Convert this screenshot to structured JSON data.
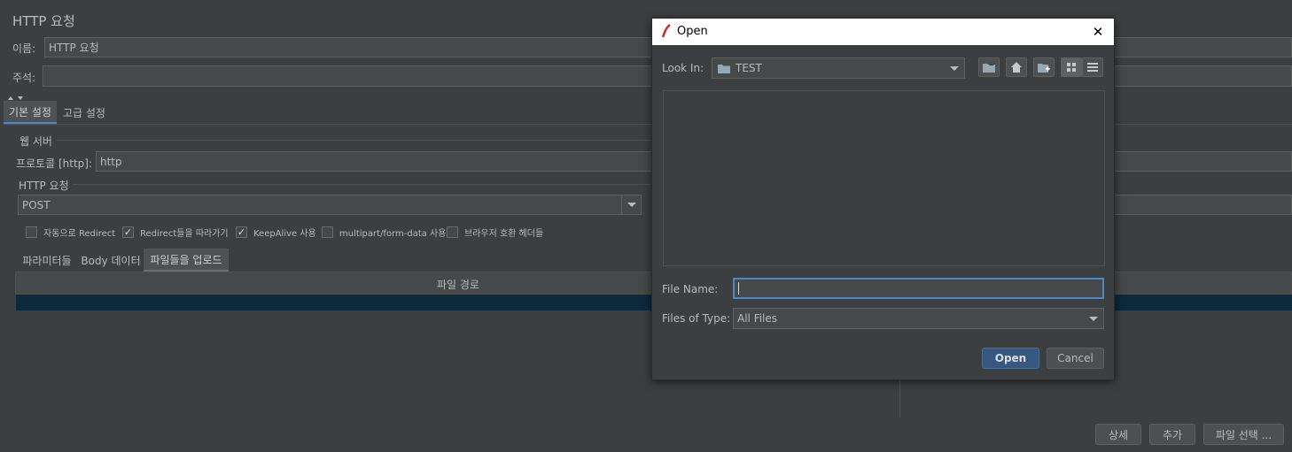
{
  "panel": {
    "title": "HTTP 요청",
    "name_label": "이름:",
    "name_value": "HTTP 요청",
    "comment_label": "주석:",
    "comment_value": "",
    "tabs": [
      "기본 설정",
      "고급 설정"
    ],
    "web_server_section": "웹 서버",
    "protocol_label": "프로토콜 [http]:",
    "protocol_value": "http",
    "http_request_section": "HTTP 요청",
    "method_value": "POST",
    "checkboxes": [
      {
        "label": "자동으로 Redirect",
        "checked": false
      },
      {
        "label": "Redirect들을 따라가기",
        "checked": true
      },
      {
        "label": "KeepAlive 사용",
        "checked": true
      },
      {
        "label": "multipart/form-data 사용",
        "checked": false
      },
      {
        "label": "브라우저 호환 헤더들",
        "checked": false
      }
    ],
    "checkmark_glyph": "✓",
    "sub_tabs": [
      "파라미터들",
      "Body 데이터",
      "파일들을 업로드"
    ],
    "table_header": "파일 경로",
    "buttons": {
      "detail": "상세",
      "add": "추가",
      "browse": "파일 선택 ..."
    }
  },
  "dialog": {
    "title": "Open",
    "close_glyph": "✕",
    "look_in_label": "Look In:",
    "look_in_value": "TEST",
    "file_name_label": "File Name:",
    "file_name_value": "",
    "files_of_type_label": "Files of Type:",
    "files_of_type_value": "All Files",
    "open_button": "Open",
    "cancel_button": "Cancel"
  },
  "colors": {
    "background": "#3c3f41",
    "field": "#45494a",
    "selection": "#0d293e",
    "accent_button": "#365880",
    "focus_border": "#4a88c7"
  }
}
